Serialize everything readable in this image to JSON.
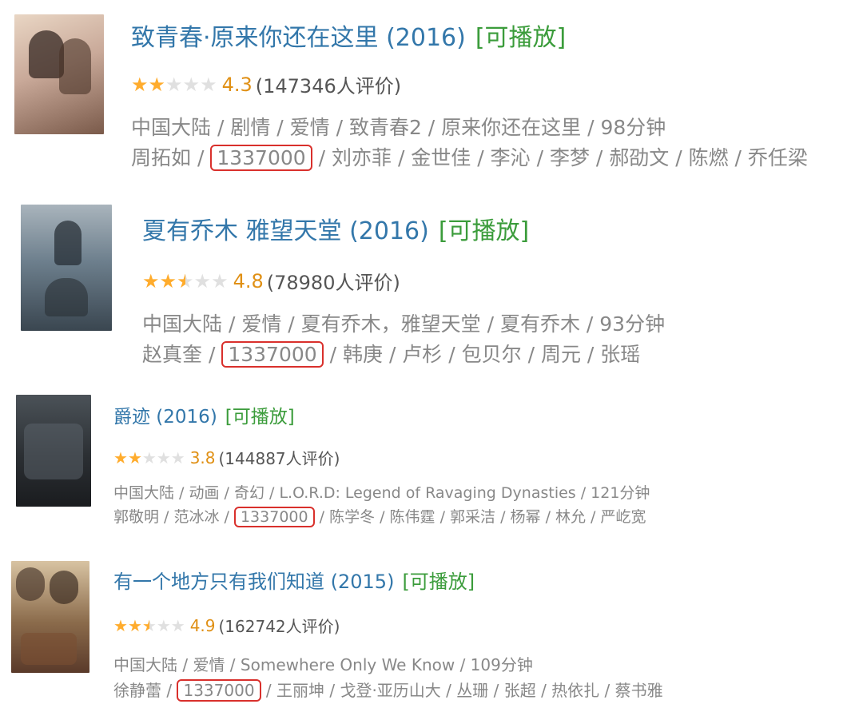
{
  "entries": [
    {
      "title": "致青春·原来你还在这里 (2016)",
      "playable": "[可播放]",
      "stars": [
        "full",
        "full",
        "empty",
        "empty",
        "empty"
      ],
      "score": "4.3",
      "votes": "(147346人评价)",
      "meta": "中国大陆 / 剧情 / 爱情 / 致青春2 / 原来你还在这里 / 98分钟",
      "cast_before": "周拓如 /",
      "highlight": "1337000",
      "cast_after": "/ 刘亦菲 / 金世佳 / 李沁 / 李梦 / 郝劭文 / 陈燃 / 乔任梁",
      "poster_colors": [
        "#c9a999",
        "#7a5a4a",
        "#e9d6c4"
      ]
    },
    {
      "title": "夏有乔木 雅望天堂 (2016)",
      "playable": "[可播放]",
      "stars": [
        "full",
        "full",
        "half",
        "empty",
        "empty"
      ],
      "score": "4.8",
      "votes": "(78980人评价)",
      "meta": "中国大陆 / 爱情 / 夏有乔木，雅望天堂 / 夏有乔木 / 93分钟",
      "cast_before": "赵真奎 /",
      "highlight": "1337000",
      "cast_after": "/ 韩庚 / 卢杉 / 包贝尔 / 周元 / 张瑶",
      "poster_colors": [
        "#6d7f8d",
        "#3a4650",
        "#a9b4bc"
      ]
    },
    {
      "title": "爵迹 (2016)",
      "playable": "[可播放]",
      "stars": [
        "full",
        "full",
        "empty",
        "empty",
        "empty"
      ],
      "score": "3.8",
      "votes": "(144887人评价)",
      "meta": "中国大陆 / 动画 / 奇幻 / L.O.R.D: Legend of Ravaging Dynasties / 121分钟",
      "cast_before": "郭敬明 / 范冰冰 /",
      "highlight": "1337000",
      "cast_after": "/ 陈学冬 / 陈伟霆 / 郭采洁 / 杨幂 / 林允 / 严屹宽",
      "poster_colors": [
        "#2b2f33",
        "#4b5258",
        "#1a1c1f"
      ]
    },
    {
      "title": "有一个地方只有我们知道 (2015)",
      "playable": "[可播放]",
      "stars": [
        "full",
        "full",
        "half",
        "empty",
        "empty"
      ],
      "score": "4.9",
      "votes": "(162742人评价)",
      "meta": "中国大陆 / 爱情 / Somewhere Only We Know / 109分钟",
      "cast_before": "徐静蕾 /",
      "highlight": "1337000",
      "cast_after": "/ 王丽坤 / 戈登·亚历山大 / 丛珊 / 张超 / 热依扎 / 蔡书雅",
      "poster_colors": [
        "#8b6b4b",
        "#d8c3a2",
        "#5a3a2a"
      ]
    }
  ]
}
